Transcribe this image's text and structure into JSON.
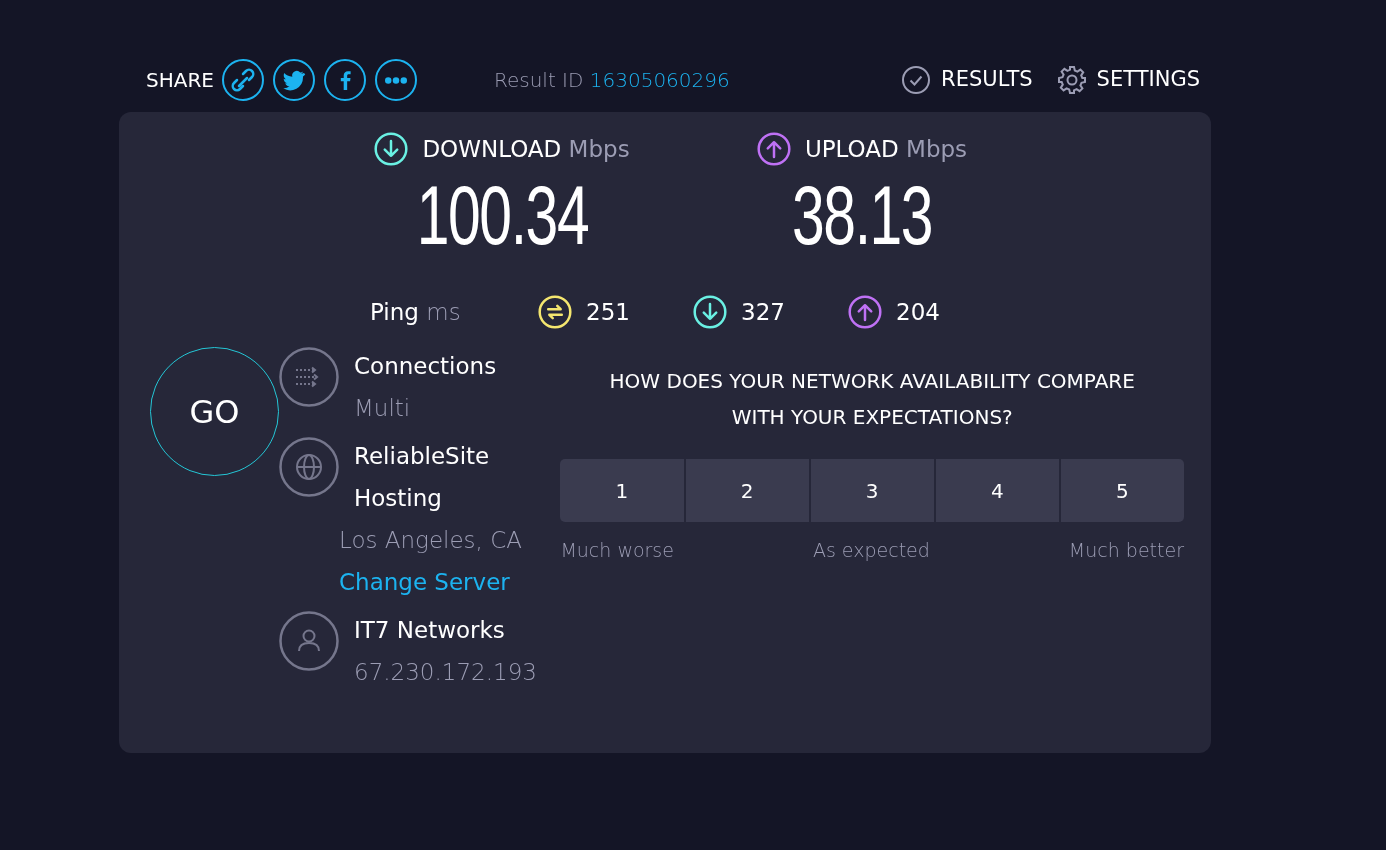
{
  "share": {
    "label": "SHARE",
    "buttons": [
      {
        "kind": "link"
      },
      {
        "kind": "twitter"
      },
      {
        "kind": "facebook"
      },
      {
        "kind": "more"
      }
    ]
  },
  "result": {
    "label": "Result ID",
    "id": "16305060296"
  },
  "nav": [
    {
      "kind": "results",
      "label": "RESULTS"
    },
    {
      "kind": "settings",
      "label": "SETTINGS"
    }
  ],
  "speeds": [
    {
      "kind": "download",
      "label": "DOWNLOAD",
      "unit": "Mbps",
      "value": "100.34",
      "color": "#6af0e3"
    },
    {
      "kind": "upload",
      "label": "UPLOAD",
      "unit": "Mbps",
      "value": "38.13",
      "color": "#bf71f5"
    }
  ],
  "ping": {
    "label": "Ping",
    "unit": "ms",
    "readings": [
      {
        "kind": "idle",
        "value": "251",
        "color": "#f4e66f"
      },
      {
        "kind": "download",
        "value": "327",
        "color": "#6af0e3"
      },
      {
        "kind": "upload",
        "value": "204",
        "color": "#bf71f5"
      }
    ]
  },
  "go": "GO",
  "info": [
    {
      "kind": "connections",
      "title": "Connections",
      "subtitle": "Multi"
    },
    {
      "kind": "server",
      "title": "ReliableSite Hosting",
      "subtitle": "Los Angeles, CA",
      "link": "Change Server"
    },
    {
      "kind": "provider",
      "title": "IT7 Networks",
      "subtitle": "67.230.172.193"
    }
  ],
  "survey": {
    "question": "HOW DOES YOUR NETWORK AVAILABILITY COMPARE WITH YOUR EXPECTATIONS?",
    "options": [
      "1",
      "2",
      "3",
      "4",
      "5"
    ],
    "scale_labels": [
      "Much worse",
      "As expected",
      "Much better"
    ]
  }
}
